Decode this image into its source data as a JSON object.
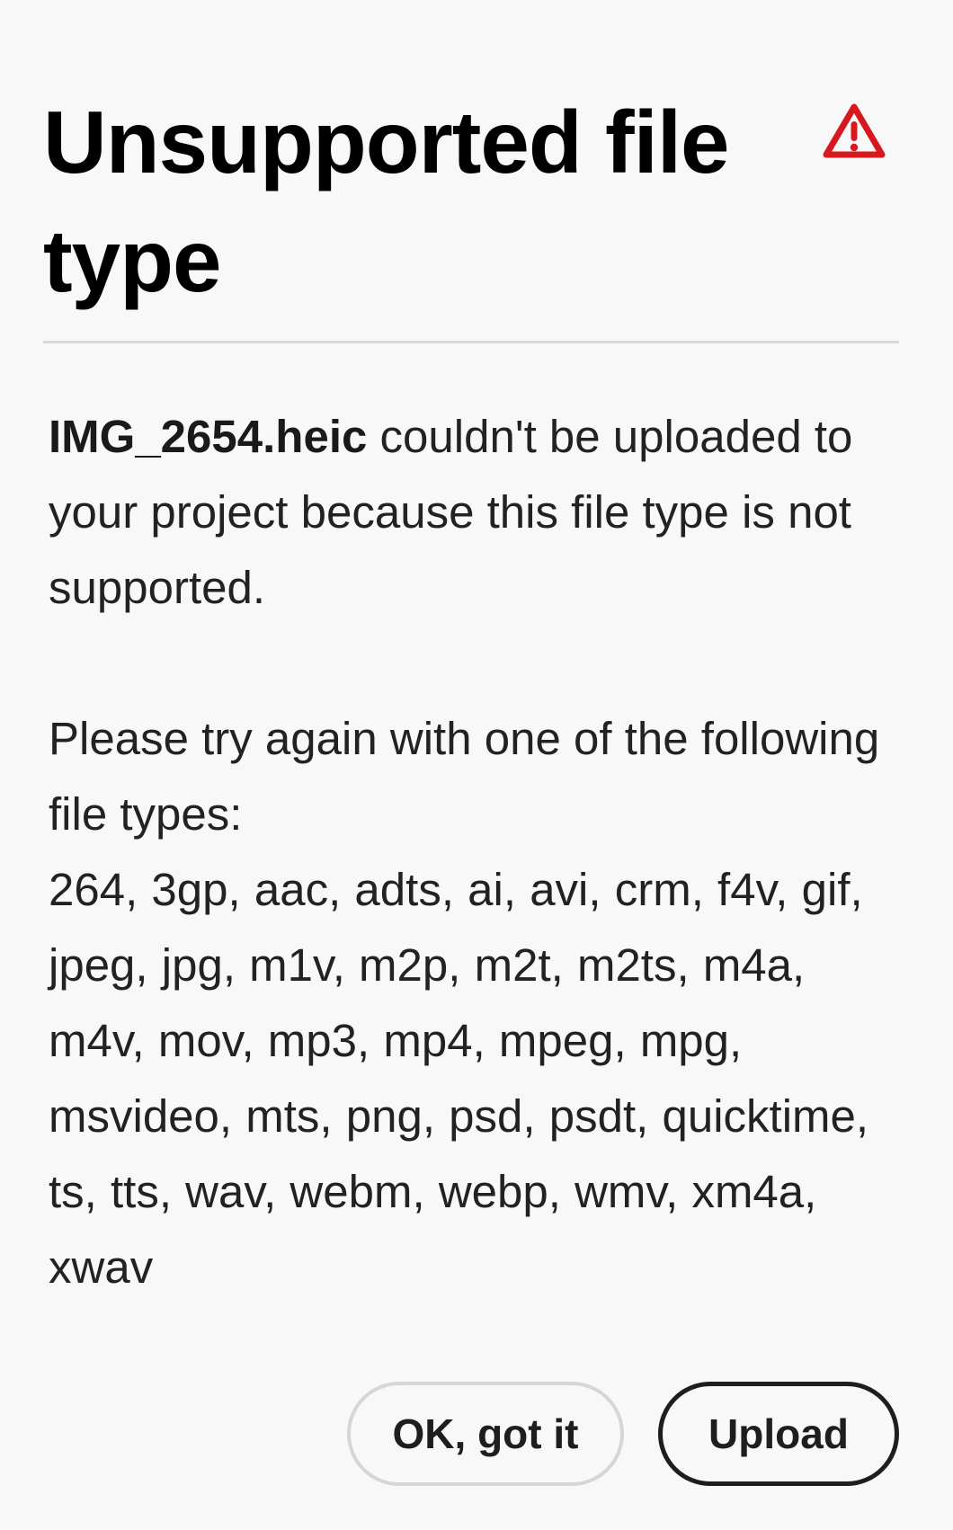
{
  "dialog": {
    "title": "Unsupported file type",
    "icon": "alert-triangle-icon",
    "accent_color": "#d7191f",
    "message": {
      "filename": "IMG_2654.heic",
      "text": " couldn't be uploaded to your project because this file type is not supported."
    },
    "instruction": "Please try again with one of the following file types:",
    "file_types": "264, 3gp, aac, adts, ai, avi, crm, f4v, gif, jpeg, jpg, m1v, m2p, m2t, m2ts, m4a, m4v, mov, mp3, mp4, mpeg, mpg, msvideo, mts, png, psd, psdt, quicktime, ts, tts, wav, webm, webp, wmv, xm4a, xwav",
    "buttons": {
      "ok_label": "OK, got it",
      "upload_label": "Upload"
    }
  }
}
